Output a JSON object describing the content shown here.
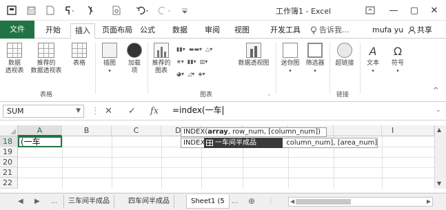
{
  "window": {
    "title": "工作簿1 - Excel",
    "minimize": "—",
    "restore": "▢",
    "close": "✕",
    "ribbon_display_icon": "ribbon-display-options-icon"
  },
  "qat": {
    "icons": [
      "excel-logo-icon",
      "save-icon",
      "new-file-icon",
      "format-painter-icon",
      "brush-icon",
      "print-preview-icon",
      "undo-icon",
      "redo-icon",
      "customize-icon"
    ]
  },
  "tabs": {
    "file": "文件",
    "items": [
      "开始",
      "插入",
      "页面布局",
      "公式",
      "数据",
      "审阅",
      "视图",
      "开发工具"
    ],
    "active": "插入",
    "tell_me": "告诉我...",
    "user": "mufa yu",
    "share": "共享"
  },
  "ribbon": {
    "groups": {
      "tables": "表格",
      "charts": "图表",
      "links": "链接"
    },
    "buttons": {
      "pivot_table": [
        "数据",
        "透视表"
      ],
      "recommended_pivot": [
        "推荐的",
        "数据透视表"
      ],
      "table": "表格",
      "illustrations": "插图",
      "addins": [
        "加载",
        "项"
      ],
      "recommended_charts": [
        "推荐的",
        "图表"
      ],
      "pivot_chart": "数据透视图",
      "sparklines": "迷你图",
      "slicer": "筛选器",
      "hyperlink": "超链接",
      "text": "文本",
      "symbols": "符号"
    }
  },
  "formula_bar": {
    "name_box": "SUM",
    "cancel": "✕",
    "enter": "✓",
    "fx": "fx",
    "value": "=index(一车"
  },
  "sheet": {
    "columns": [
      "A",
      "B",
      "C",
      "D",
      "E",
      "F",
      "G",
      "H",
      "I"
    ],
    "rows": [
      "18",
      "19",
      "20",
      "21",
      "22"
    ],
    "active_cell_value": "(一车",
    "tooltip_func": "INDEX(",
    "tooltip_bold": "array",
    "tooltip_rest": ", row_num, [column_num])",
    "tooltip2_prefix": "INDEX(",
    "tooltip2_rest": "column_num], [area_num])",
    "suggestion": "一车间半成品"
  },
  "sheet_tabs": {
    "items": [
      "三车间半成品",
      "四车间半成品",
      "Sheet1 (5"
    ],
    "ellipsis": "...",
    "more": "..."
  }
}
